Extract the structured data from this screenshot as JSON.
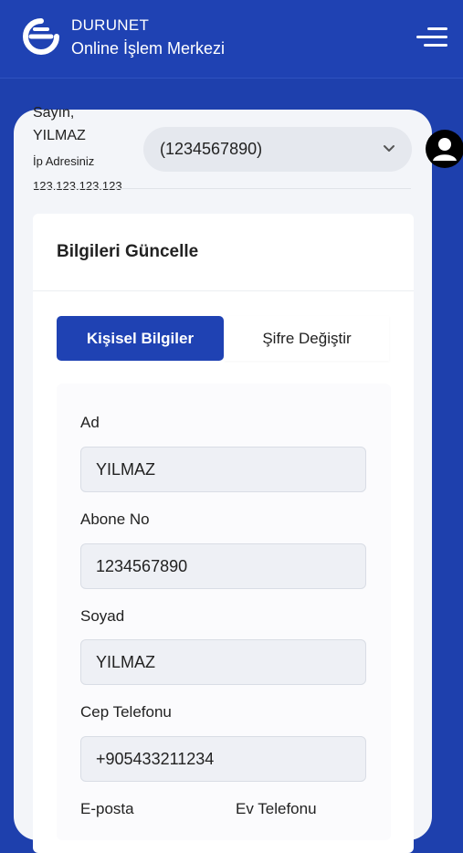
{
  "header": {
    "brand_name": "DURUNET",
    "brand_subtitle": "Online İşlem Merkezi",
    "logo_icon": "durunet-logo-icon",
    "menu_icon": "hamburger-menu-icon",
    "background_color": "#1f42b3"
  },
  "user": {
    "greeting": "Sayın,",
    "name": "YILMAZ",
    "ip_label": "İp Adresiniz",
    "ip_address": "123.123.123.123"
  },
  "account_selector": {
    "selected": "(1234567890)",
    "icon": "chevron-down-icon"
  },
  "avatar_icon": "user-avatar-icon",
  "panel": {
    "title": "Bilgileri Güncelle",
    "tabs": [
      {
        "label": "Kişisel Bilgiler",
        "active": true
      },
      {
        "label": "Şifre Değiştir",
        "active": false
      }
    ]
  },
  "form": {
    "fields": [
      {
        "label": "Ad",
        "value": "YILMAZ"
      },
      {
        "label": "Abone No",
        "value": "1234567890"
      },
      {
        "label": "Soyad",
        "value": "YILMAZ"
      },
      {
        "label": "Cep Telefonu",
        "value": "+905433211234"
      },
      {
        "label": "E-posta",
        "value": ""
      },
      {
        "label": "Ev Telefonu",
        "value": ""
      }
    ]
  },
  "colors": {
    "primary": "#1f42b3",
    "page_background": "#1e40ad",
    "input_background": "#eef0f5"
  }
}
